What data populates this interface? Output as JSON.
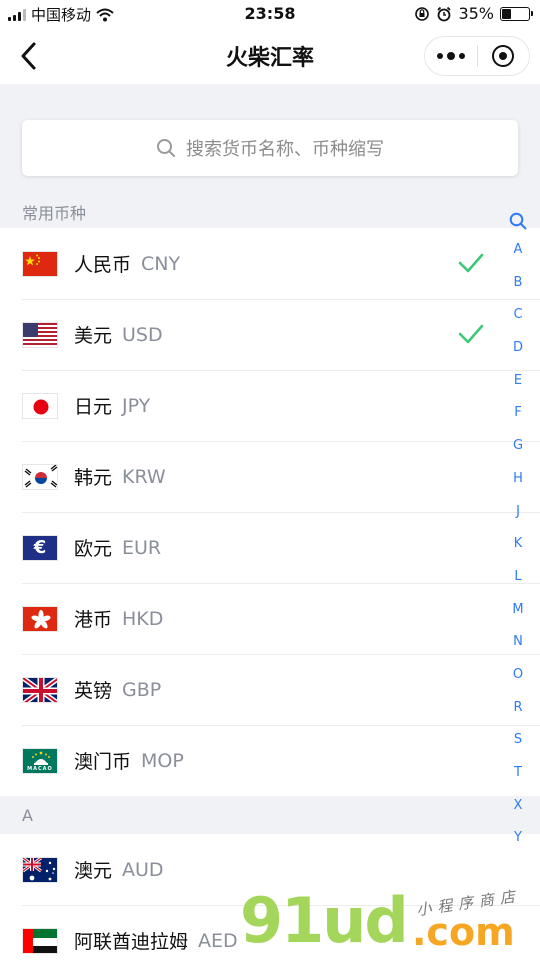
{
  "status": {
    "carrier": "中国移动",
    "time": "23:58",
    "battery_text": "35%",
    "battery_level": 0.35
  },
  "nav": {
    "title": "火柴汇率",
    "back_icon": "chevron-left-icon",
    "more_icon": "more-dots-icon",
    "close_icon": "target-icon"
  },
  "search": {
    "placeholder": "搜索货币名称、币种缩写"
  },
  "sections": {
    "common_header": "常用币种",
    "a_header": "A"
  },
  "common_currencies": [
    {
      "name": "人民币",
      "code": "CNY",
      "selected": true,
      "flag": "china-flag-icon"
    },
    {
      "name": "美元",
      "code": "USD",
      "selected": true,
      "flag": "usa-flag-icon"
    },
    {
      "name": "日元",
      "code": "JPY",
      "selected": false,
      "flag": "japan-flag-icon"
    },
    {
      "name": "韩元",
      "code": "KRW",
      "selected": false,
      "flag": "korea-flag-icon"
    },
    {
      "name": "欧元",
      "code": "EUR",
      "selected": false,
      "flag": "euro-flag-icon"
    },
    {
      "name": "港币",
      "code": "HKD",
      "selected": false,
      "flag": "hongkong-flag-icon"
    },
    {
      "name": "英镑",
      "code": "GBP",
      "selected": false,
      "flag": "uk-flag-icon"
    },
    {
      "name": "澳门币",
      "code": "MOP",
      "selected": false,
      "flag": "macao-flag-icon"
    }
  ],
  "a_currencies": [
    {
      "name": "澳元",
      "code": "AUD",
      "flag": "australia-flag-icon"
    },
    {
      "name": "阿联酋迪拉姆",
      "code": "AED",
      "flag": "uae-flag-icon"
    }
  ],
  "index_letters": [
    "A",
    "B",
    "C",
    "D",
    "E",
    "F",
    "G",
    "H",
    "J",
    "K",
    "L",
    "M",
    "N",
    "O",
    "R",
    "S",
    "T",
    "X",
    "Y"
  ],
  "flag_texts": {
    "euro": "€",
    "macao": "MACAO"
  },
  "watermark": {
    "main": "91ud",
    "domain": ".com",
    "sub": "小程序商店"
  },
  "colors": {
    "accent_blue": "#2f7bf5",
    "check_green": "#3cc77a",
    "page_bg": "#f0f2f5"
  }
}
